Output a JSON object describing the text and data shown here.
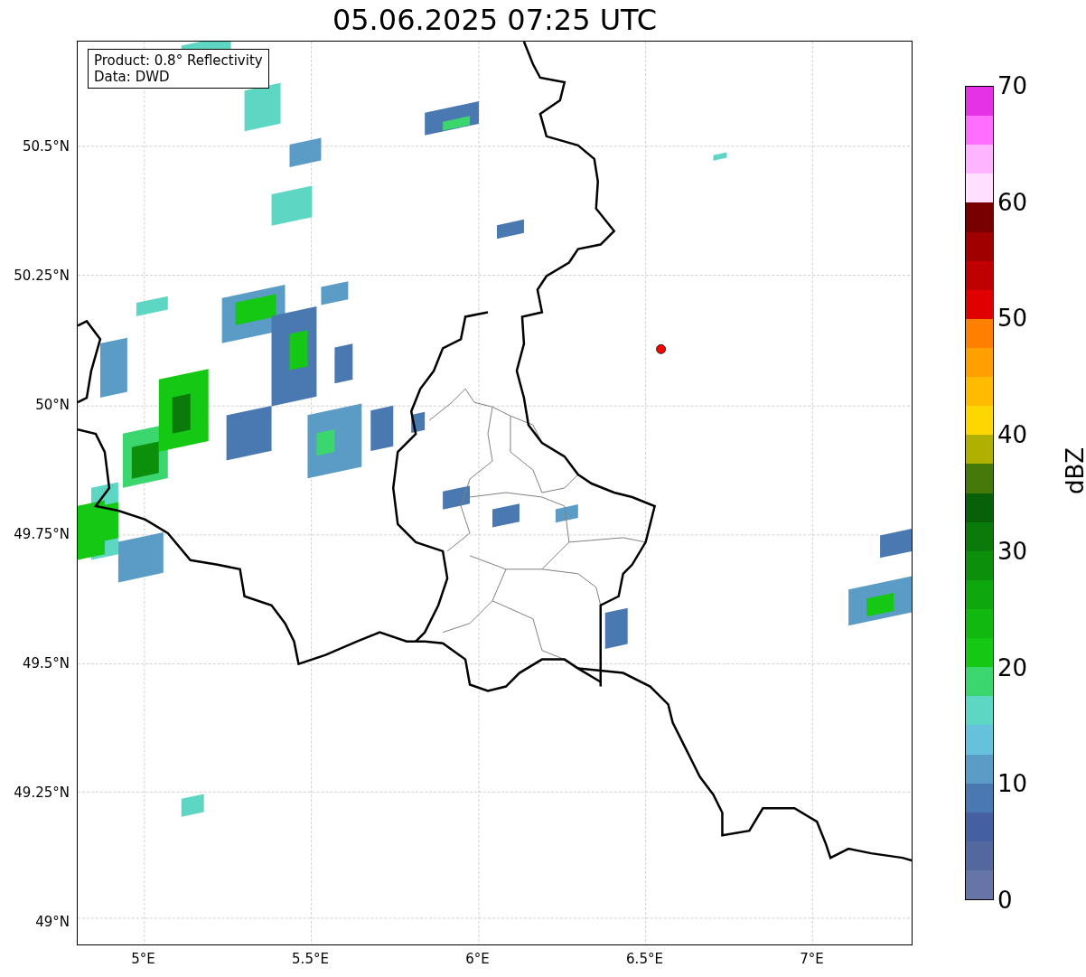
{
  "title": "05.06.2025 07:25 UTC",
  "map": {
    "info": [
      "Product: 0.8° Reflectivity",
      "Data: DWD"
    ],
    "lat_labels": [
      "50.5°N",
      "50.25°N",
      "50°N",
      "49.75°N",
      "49.5°N",
      "49.25°N",
      "49°N"
    ],
    "lon_labels": [
      "5°E",
      "5.5°E",
      "6°E",
      "6.5°E",
      "7°E"
    ]
  },
  "colorbar": {
    "label": "dBZ",
    "ticks": [
      "70",
      "60",
      "50",
      "40",
      "30",
      "20",
      "10",
      "0"
    ],
    "bands": [
      {
        "color": "#e632e6"
      },
      {
        "color": "#ff6eff"
      },
      {
        "color": "#ffb4ff"
      },
      {
        "color": "#ffe0ff"
      },
      {
        "color": "#780000"
      },
      {
        "color": "#a00000"
      },
      {
        "color": "#c00000"
      },
      {
        "color": "#e00000"
      },
      {
        "color": "#ff7f00"
      },
      {
        "color": "#ff9f00"
      },
      {
        "color": "#ffbb00"
      },
      {
        "color": "#ffd700"
      },
      {
        "color": "#b0b000"
      },
      {
        "color": "#457a0a"
      },
      {
        "color": "#086008"
      },
      {
        "color": "#0a7a0a"
      },
      {
        "color": "#0c900c"
      },
      {
        "color": "#0ea80e"
      },
      {
        "color": "#10b810"
      },
      {
        "color": "#14c814"
      },
      {
        "color": "#3cd66e"
      },
      {
        "color": "#5ed6c4"
      },
      {
        "color": "#66c2dc"
      },
      {
        "color": "#5a9cc6"
      },
      {
        "color": "#4a78b0"
      },
      {
        "color": "#4460a0"
      },
      {
        "color": "#5468a0"
      },
      {
        "color": "#6674a6"
      }
    ]
  }
}
